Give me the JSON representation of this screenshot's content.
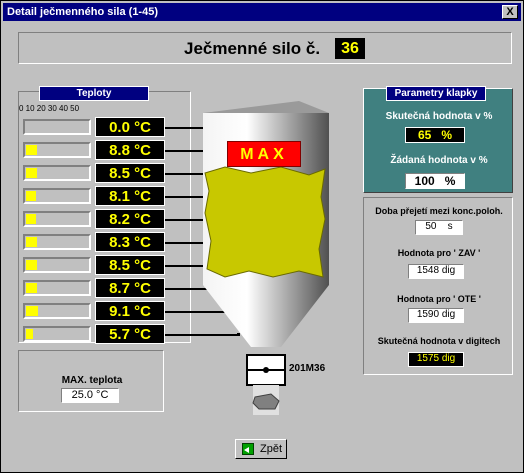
{
  "window": {
    "title": "Detail ječmenného sila (1-45)",
    "close_label": "X"
  },
  "header": {
    "title": "Ječmenné silo č.",
    "silo_number": "36"
  },
  "teploty": {
    "title": "Teploty",
    "scale": "0  10  20  30  40  50",
    "readings": [
      {
        "value": "0.0 °C",
        "level": 0.0
      },
      {
        "value": "8.8 °C",
        "level": 0.176
      },
      {
        "value": "8.5 °C",
        "level": 0.17
      },
      {
        "value": "8.1 °C",
        "level": 0.162
      },
      {
        "value": "8.2 °C",
        "level": 0.164
      },
      {
        "value": "8.3 °C",
        "level": 0.166
      },
      {
        "value": "8.5 °C",
        "level": 0.17
      },
      {
        "value": "8.7 °C",
        "level": 0.174
      },
      {
        "value": "9.1 °C",
        "level": 0.182
      },
      {
        "value": "5.7 °C",
        "level": 0.114
      }
    ]
  },
  "silo": {
    "max_label": "MAX",
    "valve_label": "201M36"
  },
  "max_teplota": {
    "label": "MAX. teplota",
    "value": "25.0 °C"
  },
  "klapka": {
    "title": "Parametry klapky",
    "actual_label": "Skutečná hodnota v %",
    "actual_value": "65",
    "actual_unit": "%",
    "target_label": "Žádaná hodnota v %",
    "target_value": "100",
    "target_unit": "%"
  },
  "params": {
    "transfer_label": "Doba přejetí mezi konc.poloh.",
    "transfer_value": "50",
    "transfer_unit": "s",
    "zav_label": "Hodnota pro ' ZAV '",
    "zav_value": "1548 dig",
    "ote_label": "Hodnota pro ' OTE '",
    "ote_value": "1590 dig",
    "actual_dig_label": "Skutečná hodnota v digitech",
    "actual_dig_value": "1575 dig"
  },
  "buttons": {
    "back_label": "Zpět"
  },
  "colors": {
    "title_bar": "#000080",
    "panel_teal": "#408080",
    "display_bg": "#000000",
    "display_fg": "#ffff00",
    "max_bg": "#ff0000",
    "grain": "#c8c800"
  }
}
